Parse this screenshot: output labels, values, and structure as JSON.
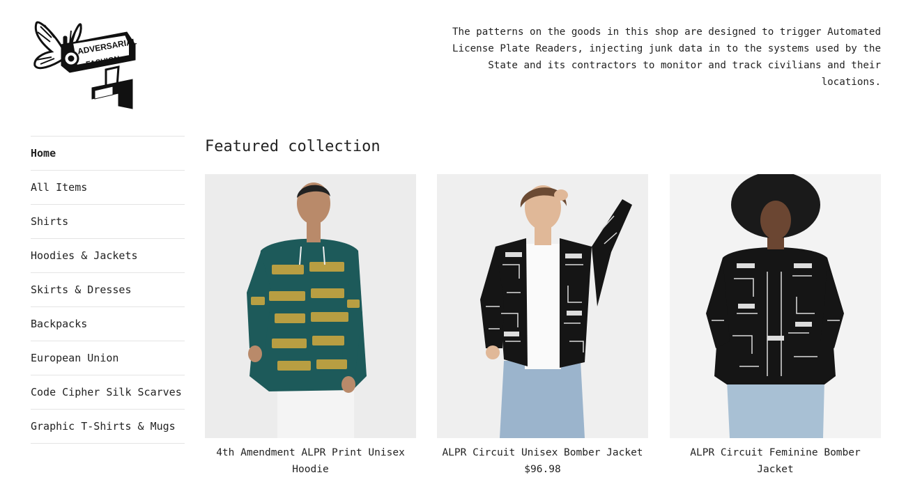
{
  "header": {
    "tagline": "The patterns on the goods in this shop are designed to trigger Automated License Plate Readers, injecting junk data in to the systems used by the State and its contractors to monitor and track civilians and their locations."
  },
  "sidebar": {
    "items": [
      {
        "label": "Home"
      },
      {
        "label": "All Items"
      },
      {
        "label": "Shirts"
      },
      {
        "label": "Hoodies & Jackets"
      },
      {
        "label": "Skirts & Dresses"
      },
      {
        "label": "Backpacks"
      },
      {
        "label": "European Union"
      },
      {
        "label": "Code Cipher Silk Scarves"
      },
      {
        "label": "Graphic T-Shirts & Mugs"
      }
    ]
  },
  "main": {
    "section_title": "Featured collection",
    "products": [
      {
        "title": "4th Amendment ALPR Print Unisex Hoodie",
        "price": "",
        "image_icon": "hoodie-model-photo",
        "pattern_color": "#1d5a5a"
      },
      {
        "title": "ALPR Circuit Unisex Bomber Jacket",
        "price": "$96.98",
        "image_icon": "bomber-jacket-model-photo",
        "pattern_color": "#151515"
      },
      {
        "title": "ALPR Circuit Feminine Bomber Jacket",
        "price": "",
        "image_icon": "feminine-bomber-model-photo",
        "pattern_color": "#151515"
      }
    ]
  },
  "colors": {
    "text": "#222222",
    "divider": "#e4e4e4",
    "photo_background": "#ececec"
  }
}
